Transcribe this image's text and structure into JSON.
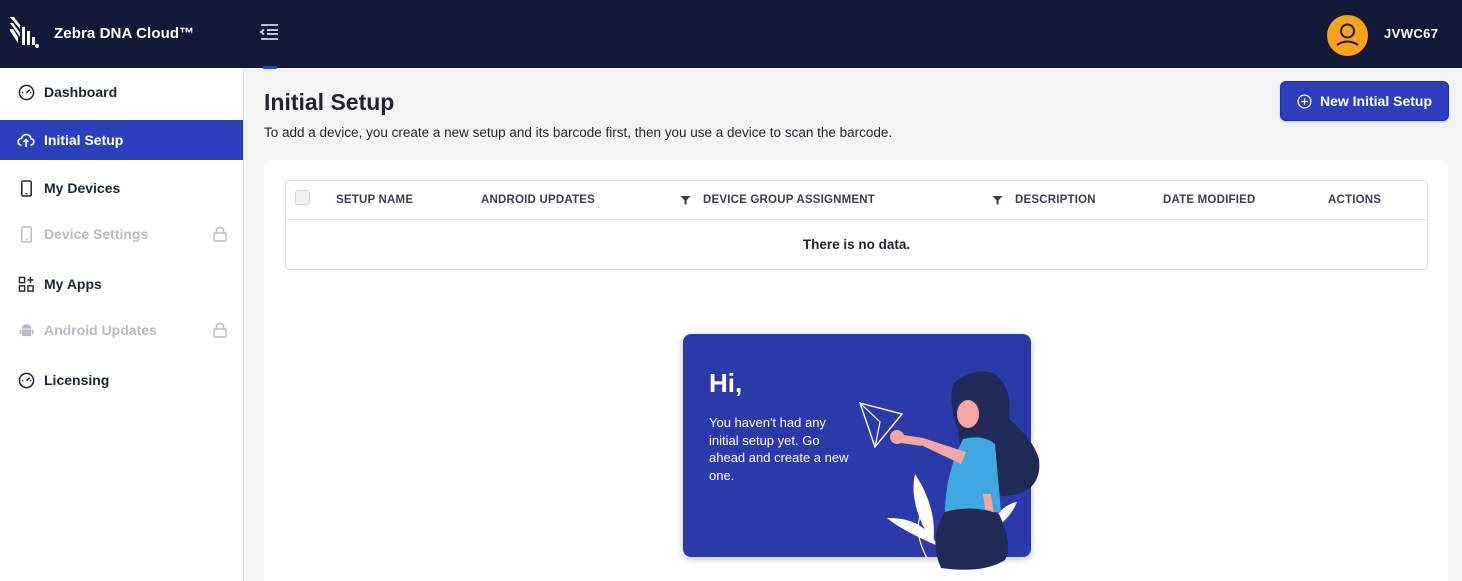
{
  "app": {
    "name": "Zebra DNA Cloud™",
    "user": "JVWC67"
  },
  "sidebar": {
    "items": [
      {
        "label": "Dashboard",
        "icon": "gauge-icon",
        "state": "normal"
      },
      {
        "label": "Initial Setup",
        "icon": "cloud-upload-icon",
        "state": "active"
      },
      {
        "label": "My Devices",
        "icon": "phone-icon",
        "state": "normal"
      },
      {
        "label": "Device Settings",
        "icon": "phone-icon",
        "state": "locked"
      },
      {
        "label": "My Apps",
        "icon": "apps-grid-icon",
        "state": "normal"
      },
      {
        "label": "Android Updates",
        "icon": "android-icon",
        "state": "locked"
      },
      {
        "label": "Licensing",
        "icon": "gauge-icon",
        "state": "normal"
      }
    ]
  },
  "main": {
    "title": "Initial Setup",
    "subtitle": "To add a device, you create a new setup and its barcode first, then you use a device to scan the barcode.",
    "new_button": "New Initial Setup"
  },
  "table": {
    "columns": [
      "SETUP NAME",
      "ANDROID UPDATES",
      "DEVICE GROUP ASSIGNMENT",
      "DESCRIPTION",
      "DATE MODIFIED",
      "ACTIONS"
    ],
    "empty_text": "There is no data."
  },
  "empty_state": {
    "greeting": "Hi,",
    "message": "You haven't had any initial setup yet. Go ahead and create a new one."
  },
  "colors": {
    "topbar": "#131a38",
    "accent": "#2b3fbd",
    "avatar": "#f7a21b"
  }
}
